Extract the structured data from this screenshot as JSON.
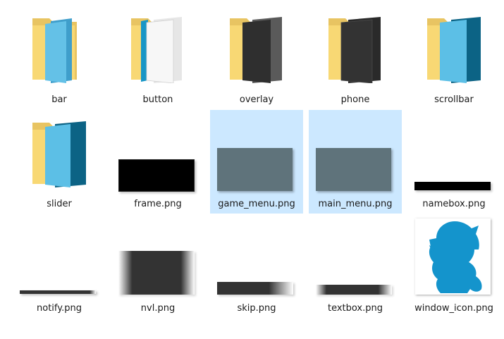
{
  "files": [
    {
      "name": "bar",
      "type": "folder",
      "icon": "folder-icon",
      "selected": false
    },
    {
      "name": "button",
      "type": "folder",
      "icon": "folder-icon",
      "selected": false
    },
    {
      "name": "overlay",
      "type": "folder",
      "icon": "folder-icon",
      "selected": false
    },
    {
      "name": "phone",
      "type": "folder",
      "icon": "folder-icon",
      "selected": false
    },
    {
      "name": "scrollbar",
      "type": "folder",
      "icon": "folder-icon",
      "selected": false
    },
    {
      "name": "slider",
      "type": "folder",
      "icon": "folder-icon",
      "selected": false
    },
    {
      "name": "frame.png",
      "type": "image",
      "icon": "image-thumbnail",
      "selected": false
    },
    {
      "name": "game_menu.png",
      "type": "image",
      "icon": "image-thumbnail",
      "selected": true
    },
    {
      "name": "main_menu.png",
      "type": "image",
      "icon": "image-thumbnail",
      "selected": true
    },
    {
      "name": "namebox.png",
      "type": "image",
      "icon": "image-thumbnail",
      "selected": false
    },
    {
      "name": "notify.png",
      "type": "image",
      "icon": "image-thumbnail",
      "selected": false
    },
    {
      "name": "nvl.png",
      "type": "image",
      "icon": "image-thumbnail",
      "selected": false
    },
    {
      "name": "skip.png",
      "type": "image",
      "icon": "image-thumbnail",
      "selected": false
    },
    {
      "name": "textbox.png",
      "type": "image",
      "icon": "image-thumbnail",
      "selected": false
    },
    {
      "name": "window_icon.png",
      "type": "image",
      "icon": "image-thumbnail",
      "selected": false
    }
  ],
  "colors": {
    "selection": "#cce8ff",
    "folder_back": "#e8c462",
    "folder_front": "#f8d874",
    "teal_dark": "#0c6385",
    "teal_light": "#5cbfe6",
    "menu_slate": "#5f737b",
    "window_icon_blue": "#1494cc"
  }
}
